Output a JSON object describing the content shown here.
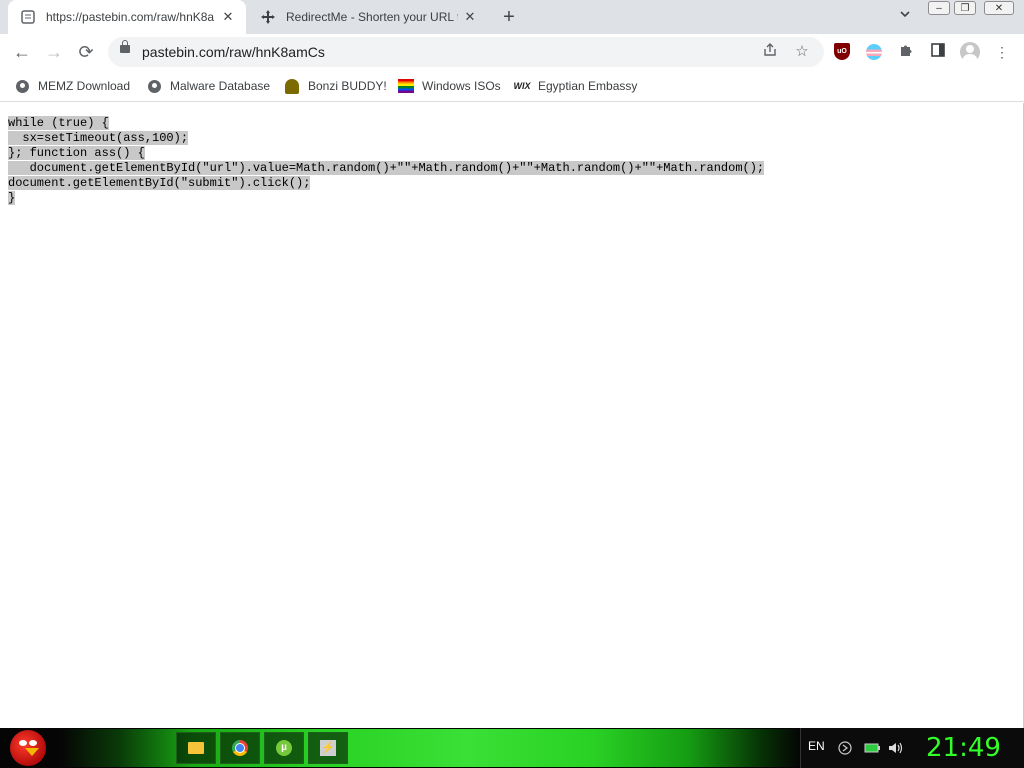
{
  "browser": {
    "tabs": [
      {
        "title": "https://pastebin.com/raw/hnK8a",
        "favicon": "document-icon",
        "active": true
      },
      {
        "title": "RedirectMe - Shorten your URL t",
        "favicon": "move-arrows-icon",
        "active": false
      }
    ],
    "new_tab_label": "+",
    "url": "pastebin.com/raw/hnK8amCs",
    "bookmarks": [
      {
        "label": "MEMZ Download",
        "icon": "globe-icon"
      },
      {
        "label": "Malware Database",
        "icon": "globe-icon"
      },
      {
        "label": "Bonzi BUDDY!",
        "icon": "bonzi-icon"
      },
      {
        "label": "Windows ISOs",
        "icon": "rainbow-flag-icon"
      },
      {
        "label": "Egyptian Embassy",
        "icon": "wix-icon"
      }
    ],
    "extensions": [
      "ublock-icon",
      "trans-flag-icon",
      "puzzle-icon",
      "side-panel-icon",
      "profile-icon"
    ]
  },
  "page": {
    "code_lines": [
      "while (true) {",
      "  sx=setTimeout(ass,100);",
      "}; function ass() {",
      "   document.getElementById(\"url\").value=Math.random()+\"\"+Math.random()+\"\"+Math.random()+\"\"+Math.random();",
      "document.getElementById(\"submit\").click();",
      "}"
    ],
    "selection_color": "#c8c8c8"
  },
  "taskbar": {
    "language": "EN",
    "time": "21:49",
    "clock_color": "#32ff28",
    "pinned": [
      "folder-icon",
      "chrome-icon",
      "utorrent-icon",
      "app-icon"
    ]
  }
}
